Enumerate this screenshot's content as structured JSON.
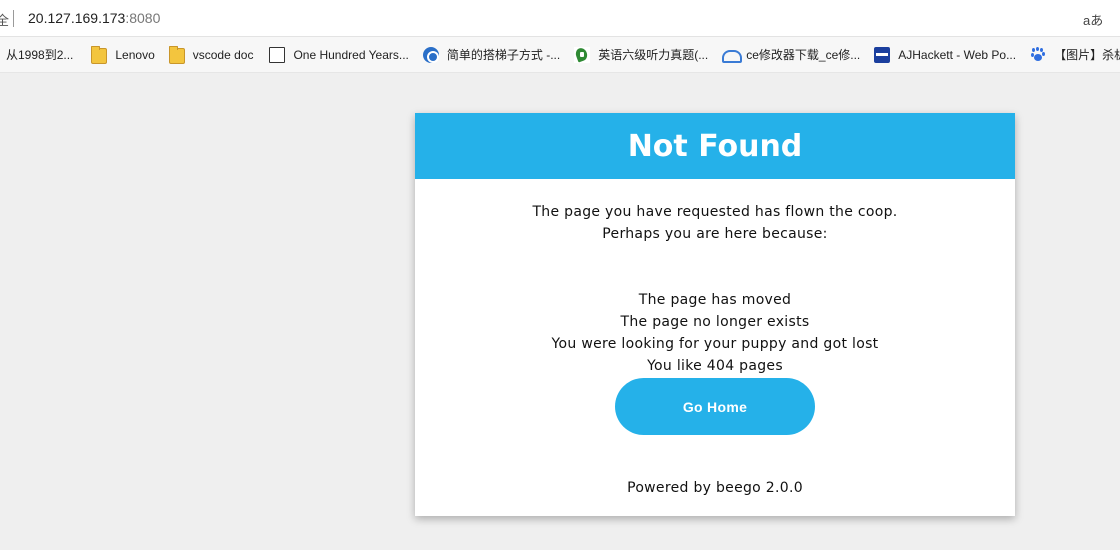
{
  "browser": {
    "address_left_glyph": "全",
    "url_host": "20.127.169.173",
    "url_port": ":8080",
    "read_aloud_label": "aあ"
  },
  "bookmarks": [
    {
      "label": "从1998到2...",
      "icon": "none"
    },
    {
      "label": "Lenovo",
      "icon": "folder-icon"
    },
    {
      "label": "vscode doc",
      "icon": "folder-icon"
    },
    {
      "label": "One Hundred Years...",
      "icon": "page-icon"
    },
    {
      "label": "简单的搭梯子方式 -...",
      "icon": "site-icon-blue"
    },
    {
      "label": "英语六级听力真题(...",
      "icon": "site-icon-green"
    },
    {
      "label": "ce修改器下载_ce修...",
      "icon": "site-icon-ce"
    },
    {
      "label": "AJHackett - Web Po...",
      "icon": "site-icon-aj"
    },
    {
      "label": "【图片】杀机",
      "icon": "baidu-paw-icon"
    }
  ],
  "page": {
    "title": "Not Found",
    "intro_lines": [
      "The page you have requested has flown the coop.",
      "Perhaps you are here because:"
    ],
    "reasons": [
      "The page has moved",
      "The page no longer exists",
      "You were looking for your puppy and got lost",
      "You like 404 pages"
    ],
    "home_button_label": "Go Home",
    "footer": "Powered by beego 2.0.0"
  },
  "colors": {
    "accent": "#25b1e9",
    "background": "#efefef",
    "card": "#ffffff"
  }
}
